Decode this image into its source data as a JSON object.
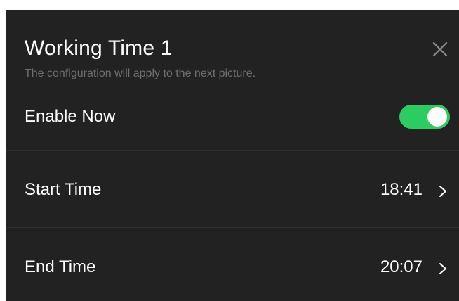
{
  "dialog": {
    "title": "Working Time 1",
    "subtitle": "The configuration will apply to the next picture.",
    "close_icon": "close-icon"
  },
  "enable_now": {
    "label": "Enable Now",
    "enabled": true,
    "toggle_color": "#2bcc60"
  },
  "start_time": {
    "label": "Start Time",
    "value": "18:41",
    "icon": "chevron-right-icon"
  },
  "end_time": {
    "label": "End Time",
    "value": "20:07",
    "icon": "chevron-right-icon"
  },
  "colors": {
    "panel_background": "#222222",
    "text": "#ffffff",
    "subtitle": "#6f6f6f"
  }
}
